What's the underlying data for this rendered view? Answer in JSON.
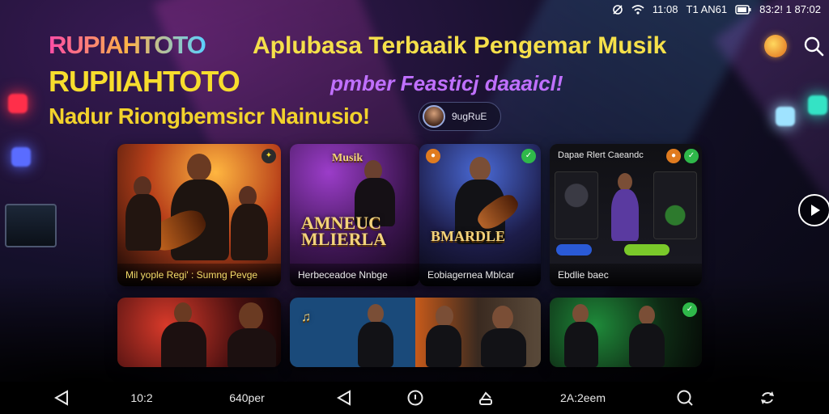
{
  "status_bar": {
    "signal": "11:08",
    "carrier": "T1 AN61",
    "clock": "83:2! 1 87:02"
  },
  "header": {
    "brand_logo": "RUPIAHTOTO",
    "headline": "Aplubasa Terbaaik Pengemar Musik",
    "brand_title": "RUPIIAHTOTO",
    "subline": "pmber Feasticj daaaicl!",
    "tagline": "Nadur Riongbemsicr Nainusio!",
    "user_chip": "9ugRuE"
  },
  "cards": [
    {
      "caption": "Mil yople Regi' : Sumng Pevge",
      "poster": ""
    },
    {
      "caption": "Herbeceadoe Nnbge",
      "poster_top": "Musik",
      "poster": "AMNEUC MLIERLA"
    },
    {
      "caption": "Eobiagernea Mblcar",
      "poster": "BMARDLE"
    },
    {
      "caption": "Ebdlie baec",
      "top_label": "Dapae Rlert Caeandc"
    },
    {
      "caption": ""
    },
    {
      "caption": ""
    },
    {
      "caption": ""
    }
  ],
  "nav": {
    "clock": "10:2",
    "center_text": "640per",
    "right_text": "2A:2eem"
  },
  "icons": [
    "mute-icon",
    "wifi-icon",
    "battery-icon",
    "search-icon",
    "play-icon",
    "back-icon",
    "home-icon",
    "recents-icon",
    "refresh-icon"
  ],
  "colors": {
    "accent_yellow": "#f7dd2d",
    "accent_purple": "#c070ff",
    "nav_bg": "#000000"
  }
}
